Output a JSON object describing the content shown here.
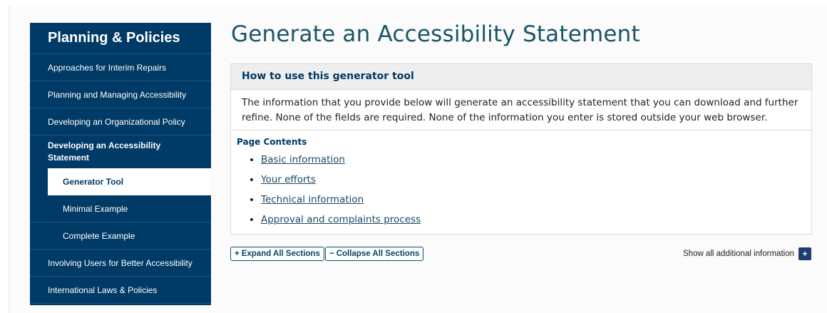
{
  "sidebar": {
    "title": "Planning & Policies",
    "items": [
      {
        "label": "Approaches for Interim Repairs"
      },
      {
        "label": "Planning and Managing Accessibility"
      },
      {
        "label": "Developing an Organizational Policy"
      },
      {
        "label": "Developing an Accessibility Statement"
      },
      {
        "label": "Generator Tool"
      },
      {
        "label": "Minimal Example"
      },
      {
        "label": "Complete Example"
      },
      {
        "label": "Involving Users for Better Accessibility"
      },
      {
        "label": "International Laws & Policies"
      }
    ]
  },
  "main": {
    "title": "Generate an Accessibility Statement",
    "info_box": {
      "heading": "How to use this generator tool",
      "body": "The information that you provide below will generate an accessibility statement that you can download and further refine. None of the fields are required. None of the information you enter is stored outside your web browser."
    },
    "page_contents": {
      "title": "Page Contents",
      "links": [
        "Basic information",
        "Your efforts",
        "Technical information",
        "Approval and complaints process"
      ]
    },
    "controls": {
      "expand_symbol": "+",
      "expand_label": "Expand All Sections",
      "collapse_symbol": "−",
      "collapse_label": "Collapse All Sections",
      "show_all_label": "Show all additional information",
      "show_all_symbol": "+"
    }
  },
  "colors": {
    "sidebar_bg": "#003a66",
    "title_color": "#1a5568",
    "link_color": "#1c4966",
    "show_all_button": "#1c3e73"
  }
}
